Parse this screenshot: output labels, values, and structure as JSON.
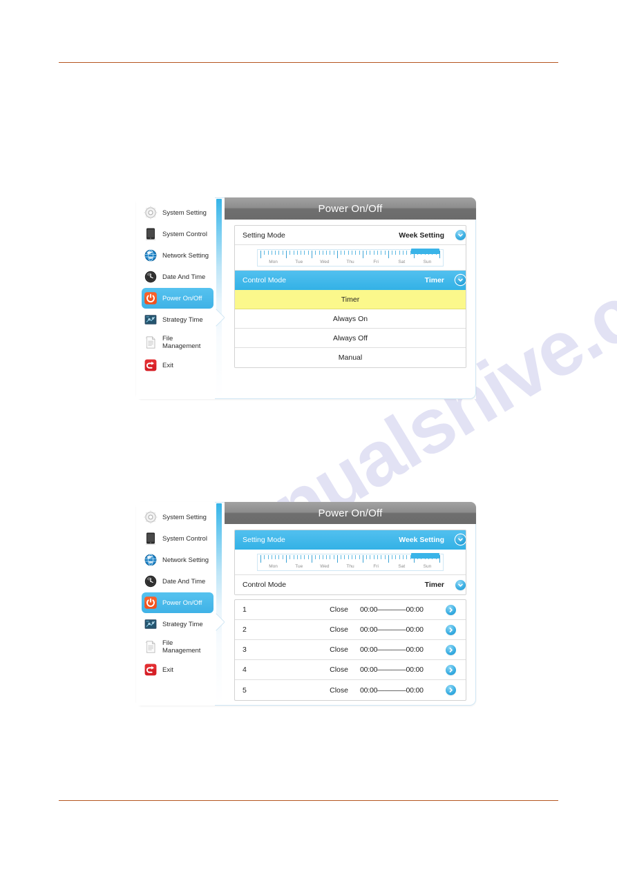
{
  "watermark": {
    "text": "manualshive.com"
  },
  "sidebar": {
    "items": [
      {
        "label": "System Setting",
        "icon": "gear-icon",
        "selected": false
      },
      {
        "label": "System Control",
        "icon": "tablet-icon",
        "selected": false
      },
      {
        "label": "Network Setting",
        "icon": "globe-icon",
        "selected": false
      },
      {
        "label": "Date And Time",
        "icon": "clock-icon",
        "selected": false
      },
      {
        "label": "Power On/Off",
        "icon": "power-icon",
        "selected": true
      },
      {
        "label": "Strategy Time",
        "icon": "strategy-icon",
        "selected": false
      },
      {
        "label": "File\nManagement",
        "icon": "document-icon",
        "selected": false
      },
      {
        "label": "Exit",
        "icon": "exit-icon",
        "selected": false
      }
    ]
  },
  "screen_one": {
    "title": "Power On/Off",
    "setting_mode": {
      "label": "Setting Mode",
      "value": "Week Setting",
      "icon": "chevron-down-icon",
      "highlighted": false
    },
    "week_ruler": {
      "days": [
        "Mon",
        "Tue",
        "Wed",
        "Thu",
        "Fri",
        "Sat",
        "Sun"
      ],
      "selected_day": "Sun"
    },
    "control_mode": {
      "label": "Control Mode",
      "value": "Timer",
      "icon": "chevron-down-icon",
      "highlighted": true
    },
    "dropdown_options": [
      {
        "label": "Timer",
        "selected": true
      },
      {
        "label": "Always On",
        "selected": false
      },
      {
        "label": "Always Off",
        "selected": false
      },
      {
        "label": "Manual",
        "selected": false
      }
    ]
  },
  "screen_two": {
    "title": "Power On/Off",
    "setting_mode": {
      "label": "Setting Mode",
      "value": "Week Setting",
      "icon": "chevron-down-icon",
      "highlighted": true
    },
    "week_ruler": {
      "days": [
        "Mon",
        "Tue",
        "Wed",
        "Thu",
        "Fri",
        "Sat",
        "Sun"
      ],
      "selected_day": "Sun"
    },
    "control_mode": {
      "label": "Control Mode",
      "value": "Timer",
      "icon": "chevron-down-icon",
      "highlighted": false
    },
    "timer_list": [
      {
        "index": "1",
        "state": "Close",
        "range": "00:00————00:00",
        "icon": "chevron-right-icon"
      },
      {
        "index": "2",
        "state": "Close",
        "range": "00:00————00:00",
        "icon": "chevron-right-icon"
      },
      {
        "index": "3",
        "state": "Close",
        "range": "00:00————00:00",
        "icon": "chevron-right-icon"
      },
      {
        "index": "4",
        "state": "Close",
        "range": "00:00————00:00",
        "icon": "chevron-right-icon"
      },
      {
        "index": "5",
        "state": "Close",
        "range": "00:00————00:00",
        "icon": "chevron-right-icon"
      }
    ]
  },
  "colors": {
    "accent_blue": "#3ab2e6",
    "highlight_yellow": "#fbf88b",
    "titlebar_gray": "#6f6f6f",
    "rule_orange": "#b5551f",
    "power_orange": "#f0511e",
    "exit_red": "#e02020"
  }
}
